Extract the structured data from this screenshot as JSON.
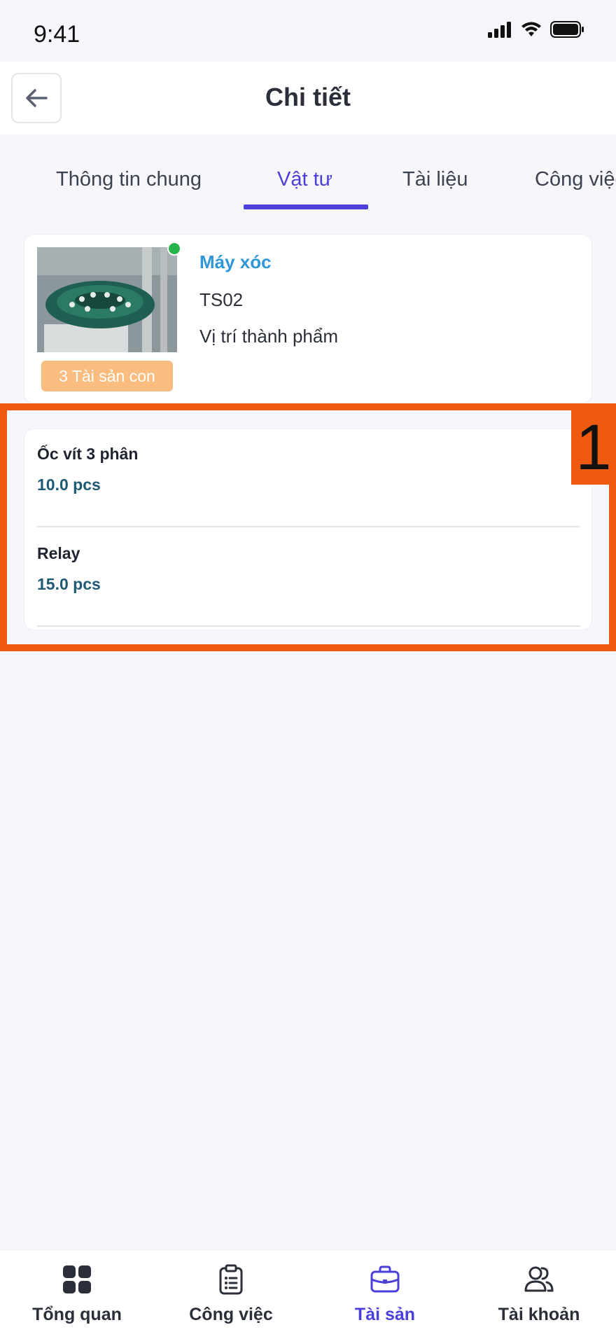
{
  "status_bar": {
    "time": "9:41"
  },
  "header": {
    "title": "Chi tiết"
  },
  "tabs": [
    {
      "label": "Thông tin chung",
      "active": false
    },
    {
      "label": "Vật tư",
      "active": true
    },
    {
      "label": "Tài liệu",
      "active": false
    },
    {
      "label": "Công việc",
      "active": false
    }
  ],
  "asset": {
    "name": "Máy xóc",
    "code": "TS02",
    "location": "Vị trí thành phẩm",
    "child_badge": "3 Tài sản con",
    "status_color": "#27b34b"
  },
  "materials": [
    {
      "name": "Ốc vít 3 phân",
      "quantity": "10.0 pcs"
    },
    {
      "name": "Relay",
      "quantity": "15.0 pcs"
    }
  ],
  "annotation": {
    "label": "1"
  },
  "bottom_nav": [
    {
      "label": "Tổng quan",
      "icon": "grid-icon",
      "active": false
    },
    {
      "label": "Công việc",
      "icon": "clipboard-icon",
      "active": false
    },
    {
      "label": "Tài sản",
      "icon": "briefcase-icon",
      "active": true
    },
    {
      "label": "Tài khoản",
      "icon": "users-icon",
      "active": false
    }
  ],
  "colors": {
    "accent": "#4b3fd9",
    "asset_name": "#2f96d8",
    "badge": "#fbbd7f",
    "quantity": "#1f5a74",
    "highlight": "#ee5a0f"
  }
}
